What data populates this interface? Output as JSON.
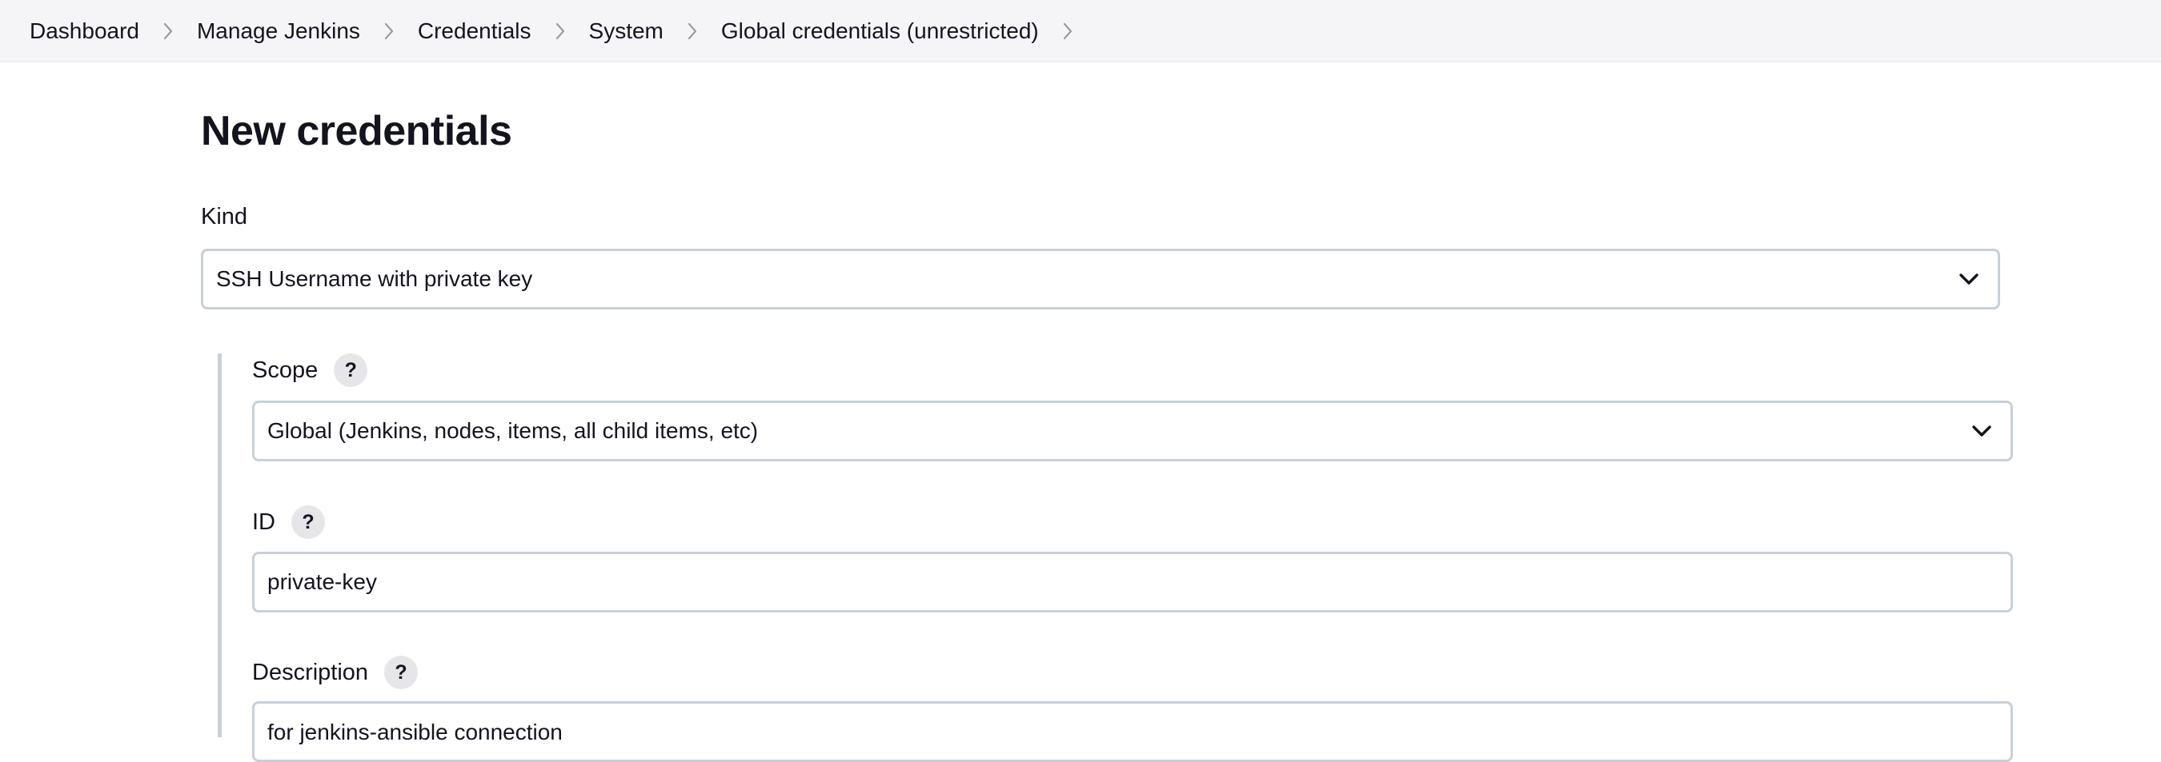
{
  "breadcrumb": {
    "items": [
      {
        "label": "Dashboard"
      },
      {
        "label": "Manage Jenkins"
      },
      {
        "label": "Credentials"
      },
      {
        "label": "System"
      },
      {
        "label": "Global credentials (unrestricted)"
      }
    ]
  },
  "page": {
    "title": "New credentials"
  },
  "form": {
    "kind": {
      "label": "Kind",
      "value": "SSH Username with private key"
    },
    "scope": {
      "label": "Scope",
      "help": "?",
      "value": "Global (Jenkins, nodes, items, all child items, etc)"
    },
    "id": {
      "label": "ID",
      "help": "?",
      "value": "private-key"
    },
    "description": {
      "label": "Description",
      "help": "?",
      "value": "for jenkins-ansible connection"
    }
  },
  "colors": {
    "breadcrumb_bg": "#f5f5f7",
    "input_border": "#c9cfd6",
    "help_bg": "#e6e6e9",
    "text": "#14141f"
  },
  "icons": [
    "chevron-right-icon",
    "chevron-down-icon",
    "help-icon"
  ]
}
